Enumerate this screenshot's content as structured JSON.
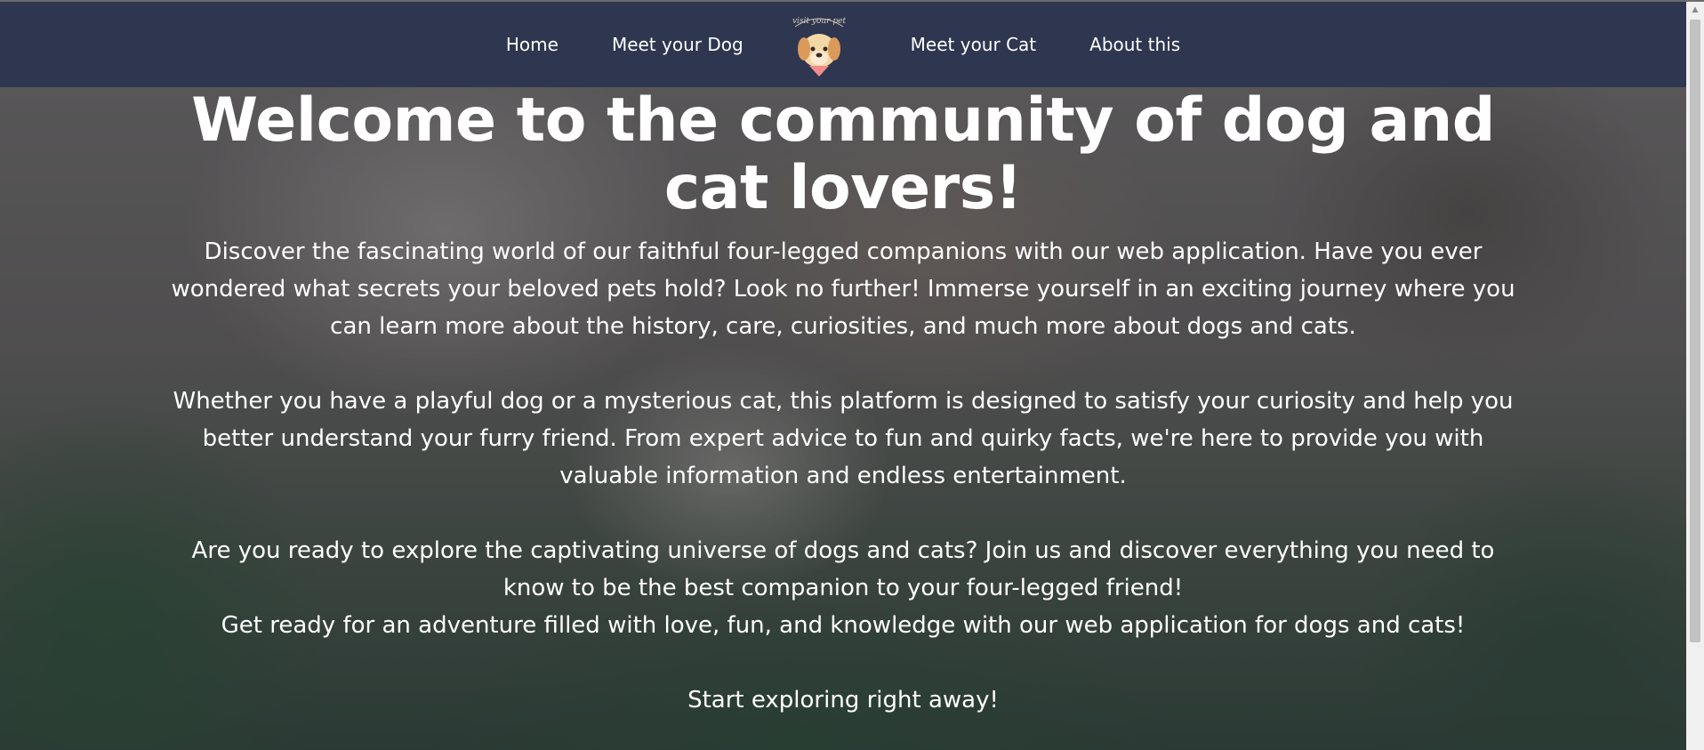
{
  "nav": {
    "links": [
      {
        "label": "Home"
      },
      {
        "label": "Meet your Dog"
      },
      {
        "label": "Meet your Cat"
      },
      {
        "label": "About this"
      }
    ],
    "logo": {
      "icon": "dog-logo-icon",
      "caption": "visit your pet"
    }
  },
  "hero": {
    "title": "Welcome to the community of dog and cat lovers!",
    "paragraphs": [
      "Discover the fascinating world of our faithful four-legged companions with our web application. Have you ever wondered what secrets your beloved pets hold? Look no further! Immerse yourself in an exciting journey where you can learn more about the history, care, curiosities, and much more about dogs and cats.",
      "Whether you have a playful dog or a mysterious cat, this platform is designed to satisfy your curiosity and help you better understand your furry friend. From expert advice to fun and quirky facts, we're here to provide you with valuable information and endless entertainment.",
      "Are you ready to explore the captivating universe of dogs and cats? Join us and discover everything you need to know to be the best companion to your four-legged friend!",
      "Get ready for an adventure filled with love, fun, and knowledge with our web application for dogs and cats!",
      "Start exploring right away!"
    ]
  },
  "colors": {
    "navbar": "#2e3650",
    "text": "#ffffff"
  }
}
